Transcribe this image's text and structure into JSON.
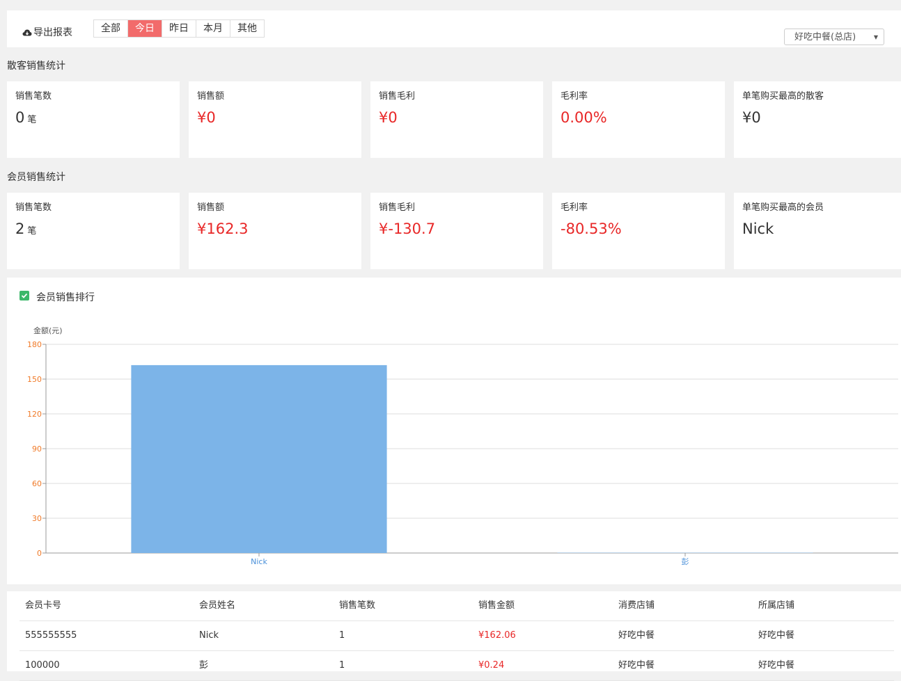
{
  "toolbar": {
    "export_label": "导出报表",
    "filters": [
      "全部",
      "今日",
      "昨日",
      "本月",
      "其他"
    ],
    "active_filter": "今日",
    "store_select": "好吃中餐(总店)"
  },
  "guest_section": {
    "title": "散客销售统计",
    "cards": [
      {
        "label": "销售笔数",
        "value": "0",
        "unit": "笔",
        "red": false
      },
      {
        "label": "销售额",
        "value": "¥0",
        "unit": "",
        "red": true
      },
      {
        "label": "销售毛利",
        "value": "¥0",
        "unit": "",
        "red": true
      },
      {
        "label": "毛利率",
        "value": "0.00%",
        "unit": "",
        "red": true
      },
      {
        "label": "单笔购买最高的散客",
        "value": "¥0",
        "unit": "",
        "red": false
      }
    ]
  },
  "member_section": {
    "title": "会员销售统计",
    "cards": [
      {
        "label": "销售笔数",
        "value": "2",
        "unit": "笔",
        "red": false
      },
      {
        "label": "销售额",
        "value": "¥162.3",
        "unit": "",
        "red": true
      },
      {
        "label": "销售毛利",
        "value": "¥-130.7",
        "unit": "",
        "red": true
      },
      {
        "label": "毛利率",
        "value": "-80.53%",
        "unit": "",
        "red": true
      },
      {
        "label": "单笔购买最高的会员",
        "value": "Nick",
        "unit": "",
        "red": false
      }
    ]
  },
  "ranking": {
    "title": "会员销售排行",
    "checked": true
  },
  "chart_data": {
    "type": "bar",
    "categories": [
      "Nick",
      "彭"
    ],
    "values": [
      162.06,
      0.24
    ],
    "ylabel": "金额(元)",
    "ylim": [
      0,
      180
    ],
    "yticks": [
      0,
      30,
      60,
      90,
      120,
      150,
      180
    ],
    "grid": true,
    "bar_color": "#7cb4e8",
    "tick_color": "#f07a28"
  },
  "table": {
    "headers": [
      "会员卡号",
      "会员姓名",
      "销售笔数",
      "销售金额",
      "消费店铺",
      "所属店铺"
    ],
    "rows": [
      [
        "555555555",
        "Nick",
        "1",
        "¥162.06",
        "好吃中餐",
        "好吃中餐"
      ],
      [
        "100000",
        "彭",
        "1",
        "¥0.24",
        "好吃中餐",
        "好吃中餐"
      ]
    ]
  },
  "colors": {
    "accent": "#f26b6b",
    "value_red": "#e82727",
    "check_green": "#3cb86a"
  }
}
